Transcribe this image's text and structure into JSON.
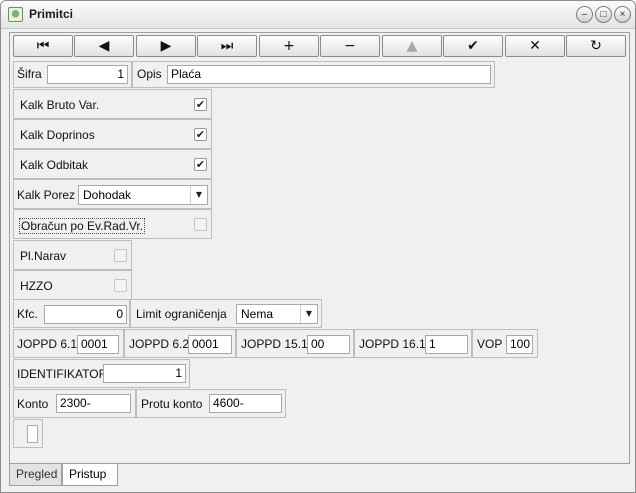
{
  "window": {
    "title": "Primitci",
    "controls": {
      "minimize": "–",
      "maximize": "□",
      "close": "×"
    }
  },
  "toolbar": {
    "first": "⏮",
    "prev": "◀",
    "next": "▶",
    "last": "⏭",
    "add": "+",
    "delete": "−",
    "edit": "▲",
    "save": "✔",
    "cancel": "✕",
    "refresh": "↻"
  },
  "form": {
    "sifra": {
      "label": "Šifra",
      "value": "1"
    },
    "opis": {
      "label": "Opis",
      "value": "Plaća"
    },
    "kalk_bruto_var": {
      "label": "Kalk Bruto Var.",
      "checked": true,
      "mark": "✔"
    },
    "kalk_doprinos": {
      "label": "Kalk Doprinos",
      "checked": true,
      "mark": "✔"
    },
    "kalk_odbitak": {
      "label": "Kalk Odbitak",
      "checked": true,
      "mark": "✔"
    },
    "kalk_porez": {
      "label": "Kalk Porez",
      "value": "Dohodak",
      "arrow": "▼"
    },
    "obracun_ev": {
      "label": "Obračun po Ev.Rad.Vr.",
      "checked": false
    },
    "pl_narav": {
      "label": "Pl.Narav",
      "checked": false
    },
    "hzzo": {
      "label": "HZZO",
      "checked": false
    },
    "kfc": {
      "label": "Kfc.",
      "value": "0"
    },
    "limit": {
      "label": "Limit ograničenja",
      "value": "Nema",
      "arrow": "▼"
    },
    "joppd61": {
      "label": "JOPPD 6.1",
      "value": "0001"
    },
    "joppd62": {
      "label": "JOPPD 6.2",
      "value": "0001"
    },
    "joppd151": {
      "label": "JOPPD 15.1",
      "value": "00"
    },
    "joppd161": {
      "label": "JOPPD 16.1",
      "value": "1"
    },
    "vop": {
      "label": "VOP",
      "value": "100"
    },
    "identifikator": {
      "label": "IDENTIFIKATOR",
      "value": "1"
    },
    "konto": {
      "label": "Konto",
      "value": "2300-"
    },
    "protu_konto": {
      "label": "Protu konto",
      "value": "4600-"
    }
  },
  "tabs": [
    {
      "label": "Pregled",
      "active": false
    },
    {
      "label": "Pristup",
      "active": true
    }
  ],
  "colors": {
    "window_bg": "#f0f0f0",
    "field_bg": "#ffffff",
    "border": "#a9a9a9"
  }
}
